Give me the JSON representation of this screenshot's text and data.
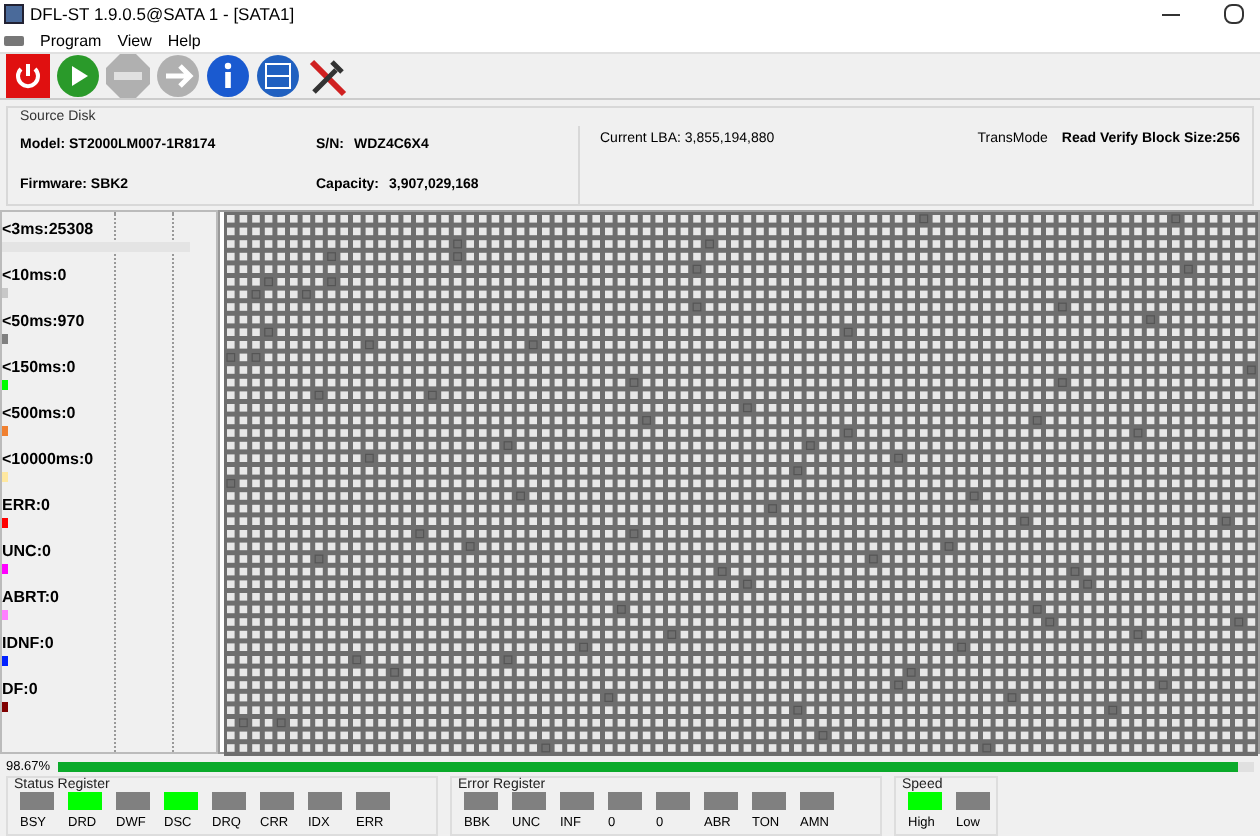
{
  "window": {
    "title": "DFL-ST 1.9.0.5@SATA 1 - [SATA1]"
  },
  "menu": [
    "Program",
    "View",
    "Help"
  ],
  "toolbar": [
    {
      "kind": "power",
      "disabled": false
    },
    {
      "kind": "play",
      "disabled": false
    },
    {
      "kind": "stop",
      "disabled": true
    },
    {
      "kind": "arrow",
      "disabled": true
    },
    {
      "kind": "info",
      "disabled": false
    },
    {
      "kind": "log",
      "disabled": false
    },
    {
      "kind": "tools",
      "disabled": false
    }
  ],
  "source_disk": {
    "title": "Source Disk",
    "model": "Model: ST2000LM007-1R8174",
    "sn_label": "S/N:",
    "sn": "WDZ4C6X4",
    "firmware": "Firmware: SBK2",
    "capacity_label": "Capacity:",
    "capacity": "3,907,029,168",
    "current_lba": "Current LBA:  3,855,194,880",
    "trans_mode": "TransMode",
    "block_size": "Read Verify Block Size:256"
  },
  "legend": [
    {
      "label": "<3ms:25308",
      "color": "#e4e4e4",
      "level": 0.96
    },
    {
      "label": "<10ms:0",
      "color": "#c8c8c8"
    },
    {
      "label": "<50ms:970",
      "color": "#808080"
    },
    {
      "label": "<150ms:0",
      "color": "#00ff00"
    },
    {
      "label": "<500ms:0",
      "color": "#f08030"
    },
    {
      "label": "<10000ms:0",
      "color": "#ffe8a0"
    },
    {
      "label": "ERR:0",
      "color": "#ff0000"
    },
    {
      "label": "UNC:0",
      "color": "#ff00ff"
    },
    {
      "label": "ABRT:0",
      "color": "#ff80ff"
    },
    {
      "label": "IDNF:0",
      "color": "#0020ff"
    },
    {
      "label": "DF:0",
      "color": "#800000"
    }
  ],
  "progress": {
    "text": "98.67%",
    "level": 0.9867
  },
  "status_register": {
    "title": "Status Register",
    "items": [
      {
        "label": "BSY",
        "on": false
      },
      {
        "label": "DRD",
        "on": true
      },
      {
        "label": "DWF",
        "on": false
      },
      {
        "label": "DSC",
        "on": true
      },
      {
        "label": "DRQ",
        "on": false
      },
      {
        "label": "CRR",
        "on": false
      },
      {
        "label": "IDX",
        "on": false
      },
      {
        "label": "ERR",
        "on": false
      }
    ]
  },
  "error_register": {
    "title": "Error Register",
    "items": [
      {
        "label": "BBK",
        "on": false
      },
      {
        "label": "UNC",
        "on": false
      },
      {
        "label": "INF",
        "on": false
      },
      {
        "label": "0",
        "on": false
      },
      {
        "label": "0",
        "on": false
      },
      {
        "label": "ABR",
        "on": false
      },
      {
        "label": "TON",
        "on": false
      },
      {
        "label": "AMN",
        "on": false
      }
    ]
  },
  "speed": {
    "title": "Speed",
    "items": [
      {
        "label": "High",
        "on": true
      },
      {
        "label": "Low",
        "on": false
      }
    ]
  }
}
